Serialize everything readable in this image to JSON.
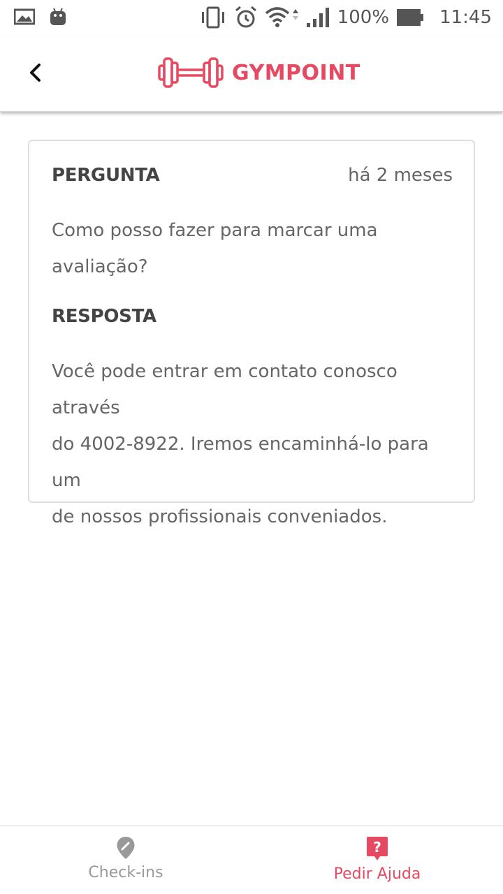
{
  "status_bar": {
    "battery": "100%",
    "time": "11:45",
    "icons": [
      "image-icon",
      "android-icon",
      "vibrate-icon",
      "alarm-icon",
      "wifi-icon",
      "signal-icon",
      "battery-icon"
    ]
  },
  "header": {
    "logo_text": "GYMPOINT",
    "brand_color": "#e54a62"
  },
  "help_order": {
    "question_label": "PERGUNTA",
    "time_ago": "há 2 meses",
    "question_line_1": "Como posso fazer para marcar uma",
    "question_line_2": "avaliação?",
    "answer_label": "RESPOSTA",
    "answer_line_1": "Você pode entrar em contato conosco através",
    "answer_line_2": "do 4002-8922. Iremos encaminhá-lo para um",
    "answer_line_3": "de nossos profissionais conveniados."
  },
  "bottom_nav": {
    "items": [
      {
        "label": "Check-ins",
        "icon": "location-pin-icon",
        "active": false
      },
      {
        "label": "Pedir Ajuda",
        "icon": "help-icon",
        "active": true
      }
    ]
  }
}
